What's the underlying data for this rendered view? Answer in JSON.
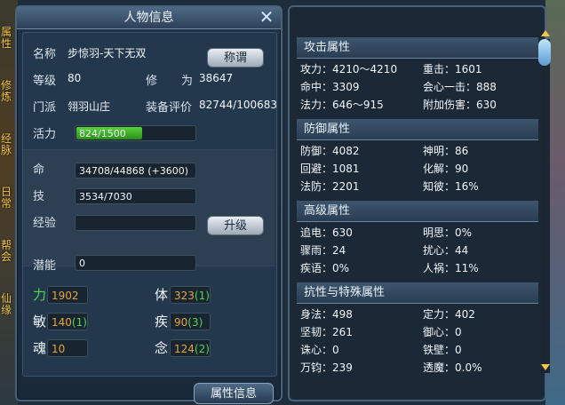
{
  "side_tabs": [
    "属性",
    "修炼",
    "经脉",
    "日常",
    "帮会",
    "仙缘"
  ],
  "left_panel": {
    "title": "人物信息",
    "name_label": "名称",
    "name_value": "步惊羽-天下无双",
    "title_button": "称谓",
    "level_label": "等级",
    "level_value": "80",
    "cultivation_label": "修",
    "cultivation_label2": "为",
    "cultivation_value": "38647",
    "sect_label": "门派",
    "sect_value": "翎羽山庄",
    "rating_label": "装备评价",
    "rating_value": "82744/100683",
    "vitality_label": "活力",
    "vitality_value": "824/1500",
    "vitality_fraction": 0.549,
    "hp_label": "命",
    "hp_value": "34708/44868 (+3600)",
    "skill_label": "技",
    "skill_value": "3534/7030",
    "exp_label": "经验",
    "exp_value": "",
    "levelup_button": "升级",
    "potential_label": "潜能",
    "potential_value": "0",
    "stats": [
      {
        "label": "力",
        "value": "1902",
        "bonus": ""
      },
      {
        "label": "体",
        "value": "323",
        "bonus": "(1)"
      },
      {
        "label": "敏",
        "value": "140",
        "bonus": "(1)"
      },
      {
        "label": "疾",
        "value": "90",
        "bonus": "(3)"
      },
      {
        "label": "魂",
        "value": "10",
        "bonus": ""
      },
      {
        "label": "念",
        "value": "124",
        "bonus": "(2)"
      }
    ],
    "attr_button": "属性信息"
  },
  "right_panel": {
    "sections": [
      {
        "title": "攻击属性",
        "rows": [
          [
            "攻力：4210～4210",
            "重击：1601"
          ],
          [
            "命中：3309",
            "会心一击：888"
          ],
          [
            "法力：646～915",
            "附加伤害：630"
          ]
        ]
      },
      {
        "title": "防御属性",
        "rows": [
          [
            "防御：4082",
            "神明：86"
          ],
          [
            "回避：1081",
            "化解：90"
          ],
          [
            "法防：2201",
            "知彼：16%"
          ]
        ]
      },
      {
        "title": "高级属性",
        "rows": [
          [
            "追电：630",
            "明思：0%"
          ],
          [
            "骤雨：24",
            "扰心：44"
          ],
          [
            "疾语：0%",
            "人祸：11%"
          ]
        ]
      },
      {
        "title": "抗性与特殊属性",
        "rows": [
          [
            "身法：498",
            "定力：402"
          ],
          [
            "坚韧：261",
            "御心：0"
          ],
          [
            "诛心：0",
            "铁壁：0"
          ],
          [
            "万钧：239",
            "透魔：0.0%"
          ]
        ]
      }
    ]
  }
}
